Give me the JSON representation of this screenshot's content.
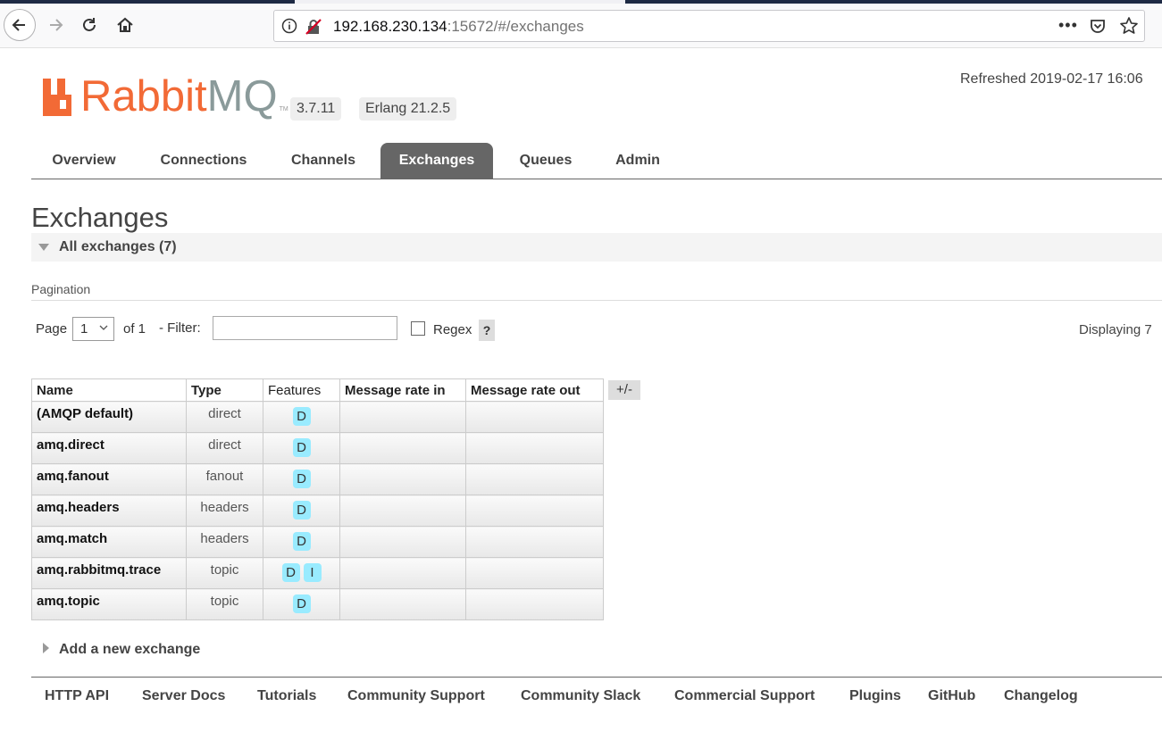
{
  "browser": {
    "url_host": "192.168.230.134",
    "url_rest": ":15672/#/exchanges",
    "more_label": "•••"
  },
  "header": {
    "logo_rabbit": "Rabbit",
    "logo_mq": "MQ",
    "logo_tm": "TM",
    "version": "3.7.11",
    "erlang": "Erlang 21.2.5",
    "refreshed": "Refreshed 2019-02-17 16:06"
  },
  "tabs": [
    {
      "label": "Overview",
      "active": false
    },
    {
      "label": "Connections",
      "active": false
    },
    {
      "label": "Channels",
      "active": false
    },
    {
      "label": "Exchanges",
      "active": true
    },
    {
      "label": "Queues",
      "active": false
    },
    {
      "label": "Admin",
      "active": false
    }
  ],
  "page": {
    "title": "Exchanges",
    "section_label": "All exchanges (7)",
    "pagination_label": "Pagination",
    "page_label": "Page",
    "page_selected": "1",
    "of_label": "of 1",
    "filter_label": "- Filter:",
    "filter_value": "",
    "regex_label": "Regex",
    "help_label": "?",
    "displaying": "Displaying 7",
    "toggle_columns": "+/-",
    "add_new": "Add a new exchange"
  },
  "table": {
    "columns": [
      "Name",
      "Type",
      "Features",
      "Message rate in",
      "Message rate out"
    ],
    "rows": [
      {
        "name": "(AMQP default)",
        "type": "direct",
        "features": [
          "D"
        ],
        "rate_in": "",
        "rate_out": ""
      },
      {
        "name": "amq.direct",
        "type": "direct",
        "features": [
          "D"
        ],
        "rate_in": "",
        "rate_out": ""
      },
      {
        "name": "amq.fanout",
        "type": "fanout",
        "features": [
          "D"
        ],
        "rate_in": "",
        "rate_out": ""
      },
      {
        "name": "amq.headers",
        "type": "headers",
        "features": [
          "D"
        ],
        "rate_in": "",
        "rate_out": ""
      },
      {
        "name": "amq.match",
        "type": "headers",
        "features": [
          "D"
        ],
        "rate_in": "",
        "rate_out": ""
      },
      {
        "name": "amq.rabbitmq.trace",
        "type": "topic",
        "features": [
          "D",
          "I"
        ],
        "rate_in": "",
        "rate_out": ""
      },
      {
        "name": "amq.topic",
        "type": "topic",
        "features": [
          "D"
        ],
        "rate_in": "",
        "rate_out": ""
      }
    ]
  },
  "footer": [
    "HTTP API",
    "Server Docs",
    "Tutorials",
    "Community Support",
    "Community Slack",
    "Commercial Support",
    "Plugins",
    "GitHub",
    "Changelog"
  ],
  "colors": {
    "brand_orange": "#f26a36",
    "brand_gray": "#8a9a9a",
    "tab_active": "#666666",
    "feature_badge": "#99ebff"
  }
}
